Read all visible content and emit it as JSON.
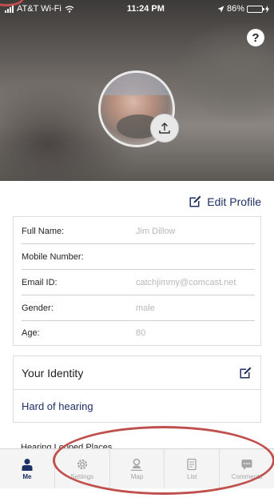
{
  "status_bar": {
    "carrier": "AT&T Wi-Fi",
    "time": "11:24 PM",
    "battery": "86%",
    "battery_level": 0.86
  },
  "header": {
    "help_label": "?"
  },
  "edit_profile": {
    "label": "Edit Profile"
  },
  "profile": {
    "fields": [
      {
        "label": "Full Name:",
        "value": "Jim Dillow"
      },
      {
        "label": "Mobile Number:",
        "value": ""
      },
      {
        "label": "Email ID:",
        "value": "catchjimmy@comcast.net"
      },
      {
        "label": "Gender:",
        "value": "male"
      },
      {
        "label": "Age:",
        "value": "80"
      }
    ]
  },
  "identity": {
    "title": "Your Identity",
    "value": "Hard of hearing"
  },
  "partial_section": {
    "label": "Hearing Looped Places"
  },
  "tabs": [
    {
      "label": "Me",
      "icon": "person-icon",
      "active": true
    },
    {
      "label": "Settings",
      "icon": "gear-icon",
      "active": false
    },
    {
      "label": "Map",
      "icon": "map-pin-person-icon",
      "active": false
    },
    {
      "label": "List",
      "icon": "list-icon",
      "active": false
    },
    {
      "label": "Comments",
      "icon": "comment-icon",
      "active": false
    }
  ],
  "colors": {
    "accent": "#1e2f63",
    "annotation": "#c0504d",
    "muted": "#a5a5a5"
  }
}
